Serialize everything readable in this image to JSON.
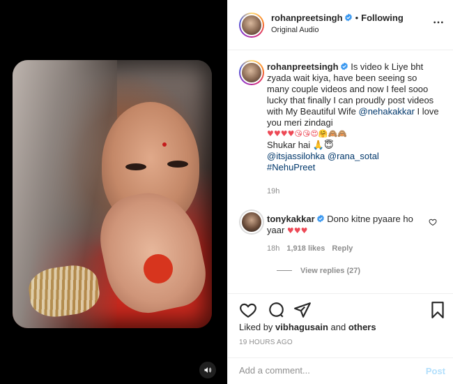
{
  "header": {
    "username": "rohanpreetsingh",
    "separator": "•",
    "follow_status": "Following",
    "audio": "Original Audio"
  },
  "caption": {
    "username": "rohanpreetsingh",
    "text": "Is video k Liye bht zyada wait kiya, have been seeing so many couple videos and now I feel sooo lucky that finally I can proudly post videos with My Beautiful Wife",
    "mention_neha": "@nehakakkar",
    "text_after": " I love you meri zindagi",
    "emojis_line": "♥♥♥♥😘😘😍🤗🙈🙈",
    "shukar": "Shukar hai 🙏😇",
    "mention_jassi": "@itsjassilohka",
    "mention_rana": "@rana_sotal",
    "hashtag": "#NehuPreet",
    "time": "19h"
  },
  "comment": {
    "username": "tonykakkar",
    "text": "Dono kitne pyaare ho yaar",
    "hearts": "♥♥♥",
    "time": "18h",
    "likes": "1,918 likes",
    "reply": "Reply",
    "view_replies": "View replies (27)"
  },
  "actions": {
    "liked_prefix": "Liked by",
    "liked_user": "vibhagusain",
    "liked_and": "and",
    "liked_others": "others",
    "time_ago": "19 HOURS AGO"
  },
  "add_comment": {
    "placeholder": "Add a comment...",
    "post_label": "Post"
  },
  "colors": {
    "verified": "#3897f0",
    "link": "#00376b",
    "heart_red": "#ed4956",
    "post_disabled": "#b2dffc"
  }
}
